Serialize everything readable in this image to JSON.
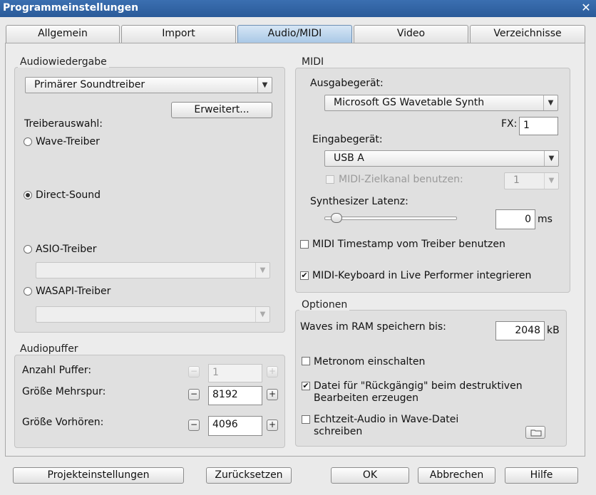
{
  "window": {
    "title": "Programmeinstellungen",
    "close_glyph": "✕"
  },
  "tabs": [
    "Allgemein",
    "Import",
    "Audio/MIDI",
    "Video",
    "Verzeichnisse"
  ],
  "audio_playback": {
    "group_label": "Audiowiedergabe",
    "driver_combo": "Primärer Soundtreiber",
    "advanced_button": "Erweitert...",
    "driver_selection_label": "Treiberauswahl:",
    "wave_driver": "Wave-Treiber",
    "direct_sound": "Direct-Sound",
    "asio_driver": "ASIO-Treiber",
    "wasapi_driver": "WASAPI-Treiber",
    "asio_combo": "",
    "wasapi_combo": ""
  },
  "midi": {
    "group_label": "MIDI",
    "output_label": "Ausgabegerät:",
    "output_combo": "Microsoft GS Wavetable Synth",
    "fx_label": "FX:",
    "fx_value": "1",
    "input_label": "Eingabegerät:",
    "input_combo": "USB A",
    "target_channel_label": "MIDI-Zielkanal benutzen:",
    "target_channel_value": "1",
    "synth_latency_label": "Synthesizer Latenz:",
    "latency_value": "0",
    "latency_unit": "ms",
    "latency_slider_fraction": 0.05,
    "timestamp_label": "MIDI Timestamp vom Treiber benutzen",
    "timestamp_checked": false,
    "keyboard_label": "MIDI-Keyboard in Live Performer integrieren",
    "keyboard_checked": true
  },
  "buffer": {
    "group_label": "Audiopuffer",
    "count_label": "Anzahl Puffer:",
    "count_value": "1",
    "multitrack_label": "Größe Mehrspur:",
    "multitrack_value": "8192",
    "preview_label": "Größe Vorhören:",
    "preview_value": "4096",
    "minus_glyph": "−",
    "plus_glyph": "+"
  },
  "options": {
    "group_label": "Optionen",
    "waves_label": "Waves im RAM speichern bis:",
    "waves_value": "2048",
    "waves_unit": "kB",
    "metronome_label": "Metronom einschalten",
    "undo_label_1": "Datei für \"Rückgängig\" beim destruktiven",
    "undo_label_2": "Bearbeiten erzeugen",
    "undo_checked": true,
    "realtime_label_1": "Echtzeit-Audio in Wave-Datei",
    "realtime_label_2": "schreiben"
  },
  "footer": {
    "project_settings": "Projekteinstellungen",
    "reset": "Zurücksetzen",
    "ok": "OK",
    "cancel": "Abbrechen",
    "help": "Hilfe"
  },
  "icons": {
    "check_glyph": "✔",
    "arrow_glyph": "▼"
  }
}
